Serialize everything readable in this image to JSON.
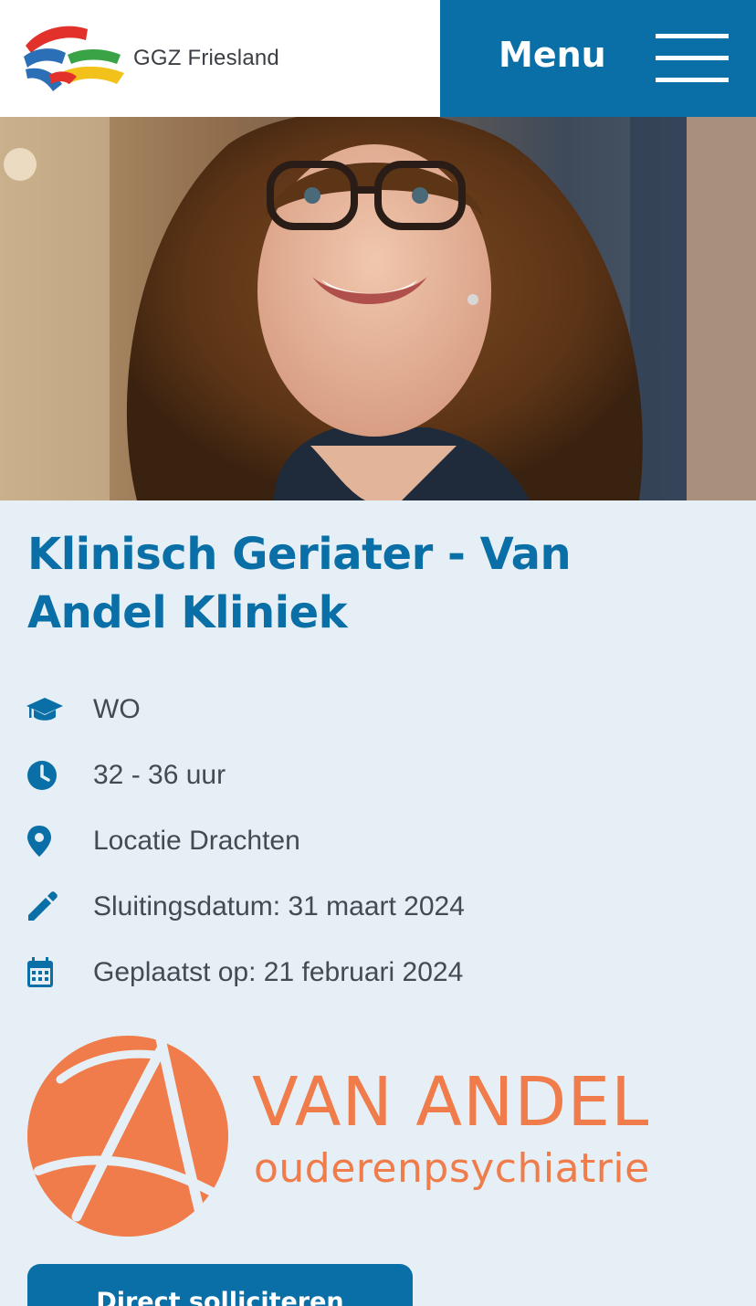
{
  "header": {
    "logo_text": "GGZ Friesland",
    "menu_label": "Menu",
    "menu_icon": "hamburger-icon",
    "brand_color": "#0a6fa6"
  },
  "hero": {
    "image": "portrait photo of smiling woman with curly hair and glasses"
  },
  "job": {
    "title": "Klinisch Geriater - Van Andel Kliniek",
    "facts": [
      {
        "icon": "graduation-cap-icon",
        "text": "WO"
      },
      {
        "icon": "clock-icon",
        "text": "32 - 36 uur"
      },
      {
        "icon": "location-pin-icon",
        "text": "Locatie Drachten"
      },
      {
        "icon": "pencil-icon",
        "text": "Sluitingsdatum: 31 maart 2024"
      },
      {
        "icon": "calendar-icon",
        "text": "Geplaatst op: 21 februari 2024"
      }
    ]
  },
  "partner_logo": {
    "name": "VAN ANDEL",
    "subtitle": "ouderenpsychiatrie",
    "color": "#ef7c4a"
  },
  "actions": {
    "apply_label": "Direct solliciteren"
  }
}
